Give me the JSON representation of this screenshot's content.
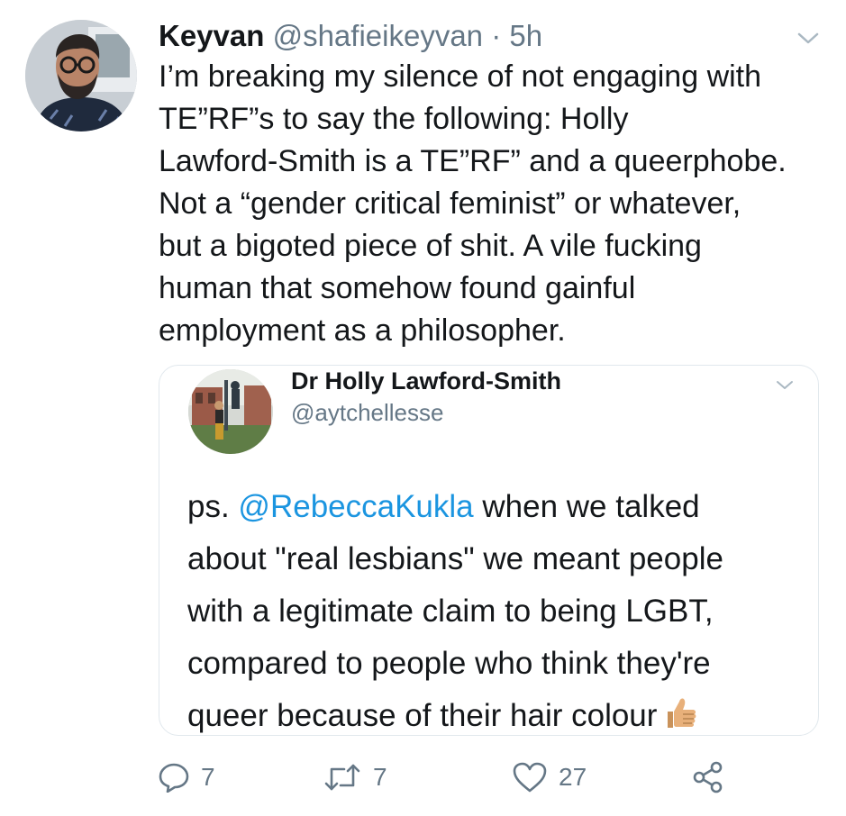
{
  "tweet": {
    "author_name": "Keyvan",
    "author_handle": "@shafieikeyvan",
    "separator": "·",
    "time": "5h",
    "lines": [
      "I’m breaking my silence of not engaging with",
      "TE”RF”s to say the following: Holly",
      "Lawford-Smith is a TE”RF” and a queerphobe.",
      "Not a “gender critical feminist” or whatever,",
      "but a bigoted piece of shit. A vile fucking",
      "human that somehow found gainful",
      "employment as a philosopher."
    ]
  },
  "quoted": {
    "author_name": "Dr Holly Lawford-Smith",
    "author_handle": "@aytchellesse",
    "line1_prefix": "ps. ",
    "line1_mention": "@RebeccaKukla",
    "line1_suffix": " when we talked",
    "lines": [
      "about \"real lesbians\" we meant people",
      "with a legitimate claim to being LGBT,",
      "compared to people who think they're"
    ],
    "last_line": "queer because of their hair colour",
    "emoji": "thumbs-up"
  },
  "actions": {
    "reply_count": "7",
    "retweet_count": "7",
    "like_count": "27"
  },
  "colors": {
    "text": "#14171a",
    "secondary": "#657786",
    "link": "#1b95e0",
    "border": "#e1e8ed"
  },
  "icons": [
    "chevron-down-icon",
    "reply-icon",
    "retweet-icon",
    "like-icon",
    "share-icon",
    "thumbs-up-emoji"
  ]
}
